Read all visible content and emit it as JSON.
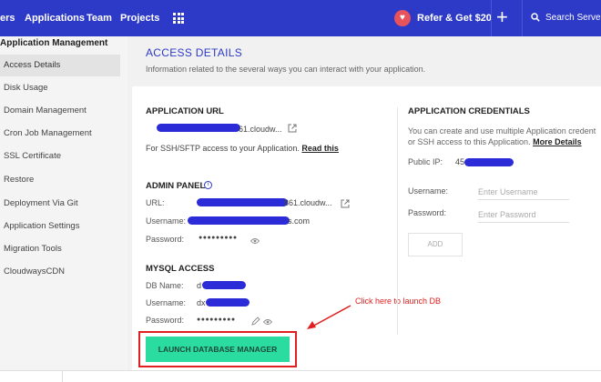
{
  "topbar": {
    "nav": [
      "ers",
      "Applications",
      "Team",
      "Projects"
    ],
    "refer_label": "Refer & Get $20",
    "add_symbol": "+",
    "search_placeholder": "Search Server o"
  },
  "sidebar": {
    "title": "Application Management",
    "items": [
      {
        "label": "Access Details",
        "active": true
      },
      {
        "label": "Disk Usage"
      },
      {
        "label": "Domain Management"
      },
      {
        "label": "Cron Job Management"
      },
      {
        "label": "SSL Certificate"
      },
      {
        "label": "Restore"
      },
      {
        "label": "Deployment Via Git"
      },
      {
        "label": "Application Settings"
      },
      {
        "label": "Migration Tools"
      },
      {
        "label": "CloudwaysCDN"
      }
    ]
  },
  "main": {
    "title": "ACCESS DETAILS",
    "description": "Information related to the several ways you can interact with your application.",
    "app_url": {
      "heading": "APPLICATION URL",
      "value_suffix": "61.cloudw...",
      "note_prefix": "For SSH/SFTP access to your Application.",
      "note_link": "Read this"
    },
    "admin_panel": {
      "heading": "ADMIN PANEL",
      "info_symbol": "i",
      "url_label": "URL:",
      "url_suffix": "861.cloudw...",
      "username_label": "Username:",
      "username_suffix": "s.com",
      "password_label": "Password:",
      "password_dots": "●●●●●●●●●"
    },
    "mysql": {
      "heading": "MYSQL ACCESS",
      "dbname_label": "DB Name:",
      "dbname_prefix": "d",
      "username_label": "Username:",
      "username_prefix": "dx",
      "password_label": "Password:",
      "password_dots": "●●●●●●●●●"
    },
    "launch_button": "LAUNCH DATABASE MANAGER",
    "annotation": "Click here to launch DB",
    "credentials": {
      "heading": "APPLICATION CREDENTIALS",
      "desc_line1": "You can create and use multiple Application credent",
      "desc_line2": "or SSH access to this Application.",
      "desc_link": "More Details",
      "public_ip_label": "Public IP:",
      "public_ip_prefix": "45",
      "username_label": "Username:",
      "username_placeholder": "Enter Username",
      "password_label": "Password:",
      "password_placeholder": "Enter Password",
      "add_button": "ADD"
    }
  },
  "colors": {
    "brand": "#2d3ac7",
    "accent_button": "#2bdca0",
    "annotation": "#e02020",
    "redaction": "#2b2bd8"
  }
}
